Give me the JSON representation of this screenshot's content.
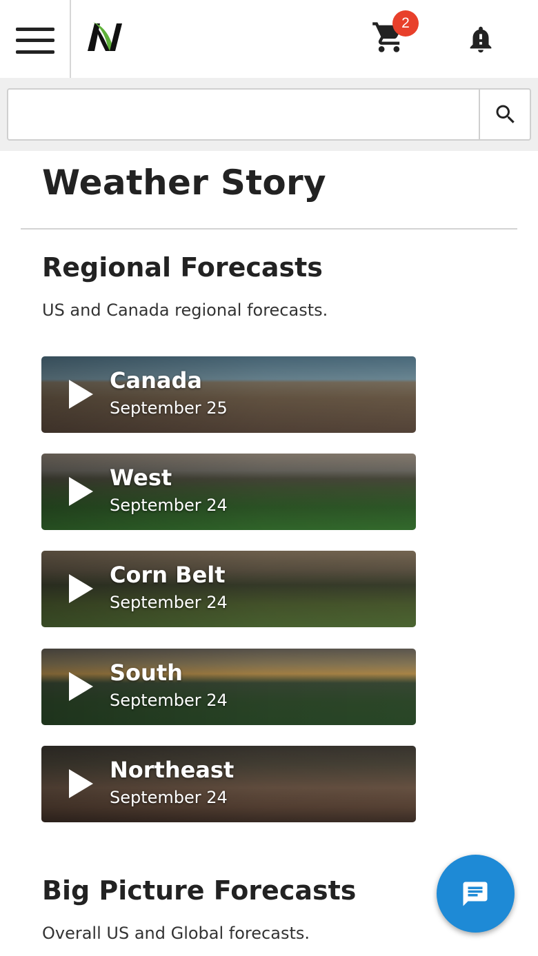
{
  "header": {
    "menu_icon": "hamburger-menu-icon",
    "logo_icon": "n-brand-logo",
    "cart_icon": "shopping-cart-icon",
    "cart_count": "2",
    "bell_icon": "bell-alert-icon"
  },
  "search": {
    "placeholder": "",
    "value": "",
    "icon": "search-icon"
  },
  "page": {
    "title": "Weather Story"
  },
  "regional": {
    "title": "Regional Forecasts",
    "description": "US and Canada regional forecasts.",
    "items": [
      {
        "title": "Canada",
        "date": "September 25"
      },
      {
        "title": "West",
        "date": "September 24"
      },
      {
        "title": "Corn Belt",
        "date": "September 24"
      },
      {
        "title": "South",
        "date": "September 24"
      },
      {
        "title": "Northeast",
        "date": "September 24"
      }
    ]
  },
  "big_picture": {
    "title": "Big Picture Forecasts",
    "description": "Overall US and Global forecasts."
  },
  "chat": {
    "icon": "chat-message-icon"
  },
  "colors": {
    "badge": "#e8402b",
    "chat_button": "#1e8ad6",
    "logo_green": "#5fb13a"
  }
}
